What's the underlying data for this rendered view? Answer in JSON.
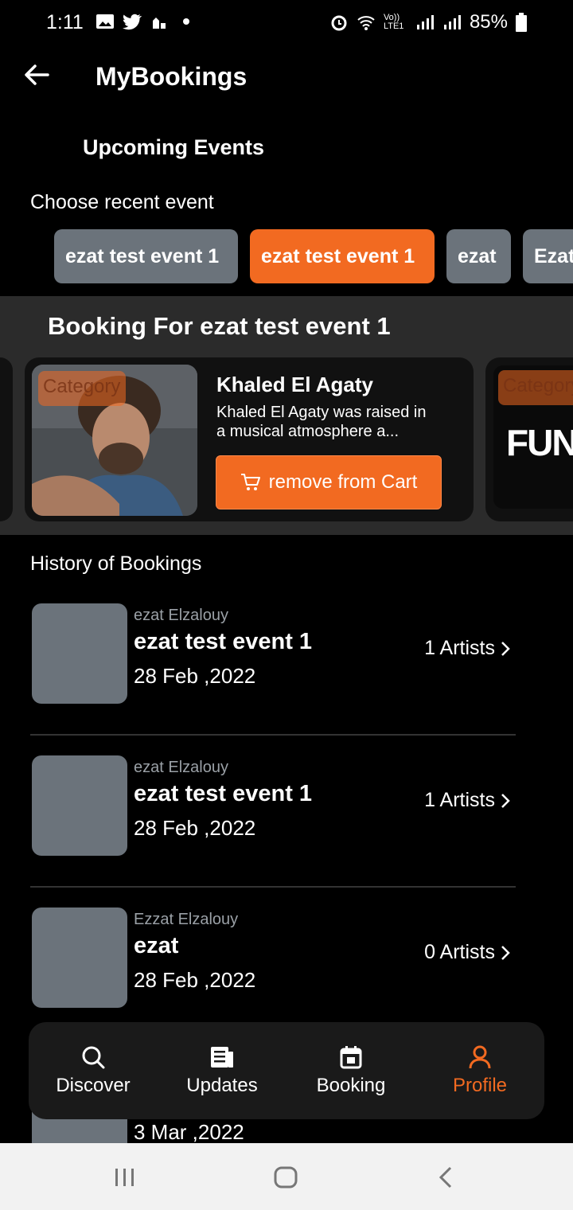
{
  "status_bar": {
    "time": "1:11",
    "battery": "85%",
    "network": "Vo)) LTE1"
  },
  "header": {
    "title": "MyBookings"
  },
  "upcoming": {
    "title": "Upcoming Events",
    "choose_label": "Choose recent event",
    "chips": [
      {
        "label": "ezat test event 1",
        "active": false
      },
      {
        "label": "ezat test event 1",
        "active": true
      },
      {
        "label": "ezat",
        "active": false
      },
      {
        "label": "Ezat",
        "active": false
      }
    ]
  },
  "booking": {
    "title": "Booking For ezat test event 1",
    "card": {
      "category_tag": "Category",
      "artist_name": "Khaled El Agaty",
      "description": "Khaled El Agaty was raised in a musical atmosphere a...",
      "cart_button": "remove from Cart"
    },
    "next_card": {
      "category_tag": "Category",
      "logo_text": "FUNN"
    }
  },
  "history": {
    "title": "History of Bookings",
    "items": [
      {
        "host": "ezat Elzalouy",
        "event": "ezat test event 1",
        "date": "28 Feb ,2022",
        "artists": "1 Artists"
      },
      {
        "host": "ezat Elzalouy",
        "event": "ezat test event 1",
        "date": "28 Feb ,2022",
        "artists": "1 Artists"
      },
      {
        "host": "Ezzat Elzalouy",
        "event": "ezat",
        "date": "28 Feb ,2022",
        "artists": "0 Artists"
      },
      {
        "host": "",
        "event": "",
        "date": "3 Mar ,2022",
        "artists": ""
      }
    ]
  },
  "nav": {
    "items": [
      {
        "label": "Discover",
        "icon": "search-icon"
      },
      {
        "label": "Updates",
        "icon": "newspaper-icon"
      },
      {
        "label": "Booking",
        "icon": "calendar-icon"
      },
      {
        "label": "Profile",
        "icon": "person-icon"
      }
    ]
  },
  "colors": {
    "accent": "#f26a21",
    "chip": "#6b737b",
    "panel": "#2b2b2b"
  }
}
